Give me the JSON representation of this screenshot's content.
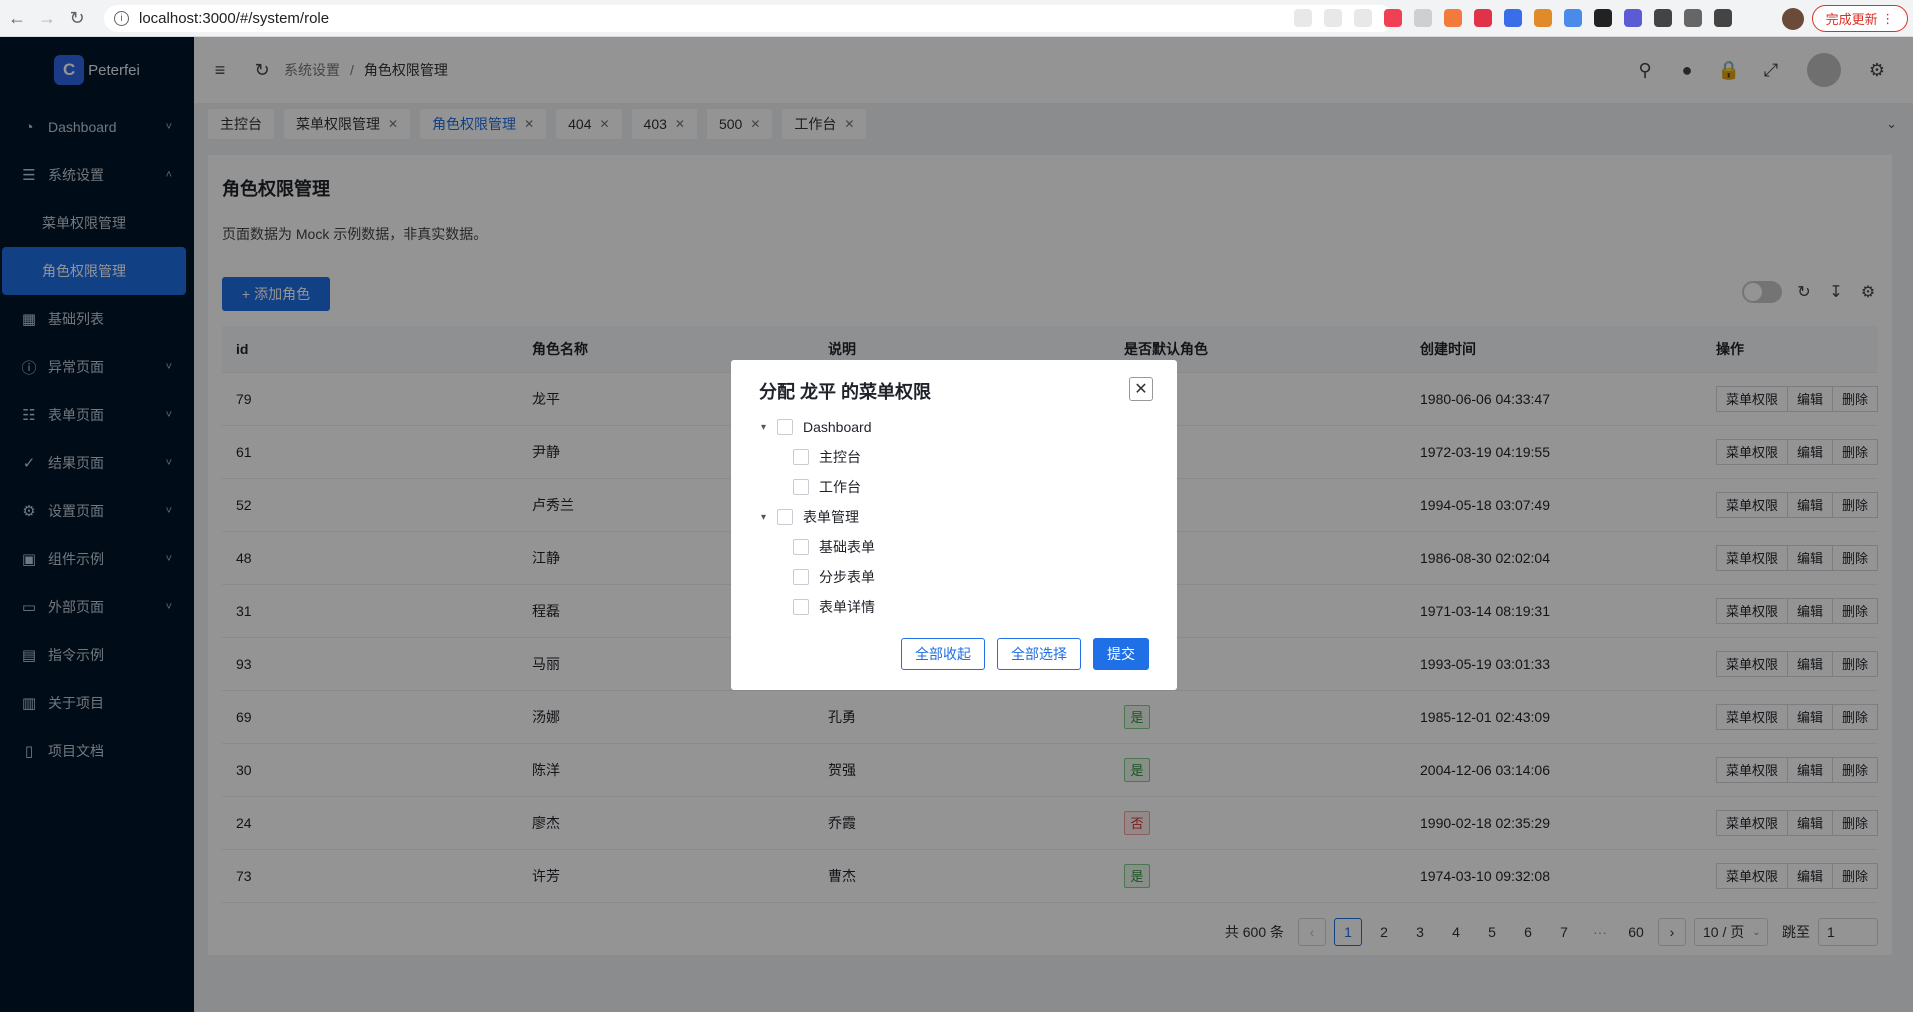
{
  "browser": {
    "url": "localhost:3000/#/system/role",
    "update_label": "完成更新"
  },
  "sidebar": {
    "brand": "Peterfei",
    "items": [
      {
        "label": "Dashboard",
        "icon": "dashboard-icon",
        "expandable": true
      },
      {
        "label": "系统设置",
        "icon": "settings-sliders-icon",
        "expandable": true,
        "expanded": true
      },
      {
        "label": "基础列表",
        "icon": "table-icon",
        "expandable": false
      },
      {
        "label": "异常页面",
        "icon": "exclamation-icon",
        "expandable": true
      },
      {
        "label": "表单页面",
        "icon": "form-icon",
        "expandable": true
      },
      {
        "label": "结果页面",
        "icon": "check-circle-icon",
        "expandable": true
      },
      {
        "label": "设置页面",
        "icon": "gear-icon",
        "expandable": true
      },
      {
        "label": "组件示例",
        "icon": "component-icon",
        "expandable": true
      },
      {
        "label": "外部页面",
        "icon": "desktop-icon",
        "expandable": true
      },
      {
        "label": "指令示例",
        "icon": "directive-icon",
        "expandable": false
      },
      {
        "label": "关于项目",
        "icon": "project-icon",
        "expandable": false
      },
      {
        "label": "项目文档",
        "icon": "document-icon",
        "expandable": false
      }
    ],
    "submenu": [
      {
        "label": "菜单权限管理",
        "active": false
      },
      {
        "label": "角色权限管理",
        "active": true
      }
    ]
  },
  "header": {
    "breadcrumb": [
      "系统设置",
      "角色权限管理"
    ],
    "breadcrumb_sep": "/"
  },
  "tabs": [
    {
      "label": "主控台",
      "closable": false,
      "active": false
    },
    {
      "label": "菜单权限管理",
      "closable": true,
      "active": false
    },
    {
      "label": "角色权限管理",
      "closable": true,
      "active": true
    },
    {
      "label": "404",
      "closable": true,
      "active": false
    },
    {
      "label": "403",
      "closable": true,
      "active": false
    },
    {
      "label": "500",
      "closable": true,
      "active": false
    },
    {
      "label": "工作台",
      "closable": true,
      "active": false
    }
  ],
  "page": {
    "title": "角色权限管理",
    "description": "页面数据为 Mock 示例数据，非真实数据。",
    "add_button": "添加角色"
  },
  "table": {
    "columns": [
      "id",
      "角色名称",
      "说明",
      "是否默认角色",
      "创建时间",
      "操作"
    ],
    "actions": [
      "菜单权限",
      "编辑",
      "删除"
    ],
    "rows": [
      {
        "id": "79",
        "name": "龙平",
        "desc": "",
        "default": "",
        "created": "1980-06-06 04:33:47"
      },
      {
        "id": "61",
        "name": "尹静",
        "desc": "",
        "default": "",
        "created": "1972-03-19 04:19:55"
      },
      {
        "id": "52",
        "name": "卢秀兰",
        "desc": "",
        "default": "",
        "created": "1994-05-18 03:07:49"
      },
      {
        "id": "48",
        "name": "江静",
        "desc": "",
        "default": "",
        "created": "1986-08-30 02:02:04"
      },
      {
        "id": "31",
        "name": "程磊",
        "desc": "",
        "default": "",
        "created": "1971-03-14 08:19:31"
      },
      {
        "id": "93",
        "name": "马丽",
        "desc": "",
        "default": "",
        "created": "1993-05-19 03:01:33"
      },
      {
        "id": "69",
        "name": "汤娜",
        "desc": "孔勇",
        "default": "是",
        "created": "1985-12-01 02:43:09"
      },
      {
        "id": "30",
        "name": "陈洋",
        "desc": "贺强",
        "default": "是",
        "created": "2004-12-06 03:14:06"
      },
      {
        "id": "24",
        "name": "廖杰",
        "desc": "乔霞",
        "default": "否",
        "created": "1990-02-18 02:35:29"
      },
      {
        "id": "73",
        "name": "许芳",
        "desc": "曹杰",
        "default": "是",
        "created": "1974-03-10 09:32:08"
      }
    ]
  },
  "pagination": {
    "total": "共 600 条",
    "pages": [
      "1",
      "2",
      "3",
      "4",
      "5",
      "6",
      "7",
      "···",
      "60"
    ],
    "current": "1",
    "page_size": "10 / 页",
    "jump_label": "跳至",
    "jump_value": "1"
  },
  "modal": {
    "title": "分配 龙平 的菜单权限",
    "tree": [
      {
        "label": "Dashboard",
        "children": [
          "主控台",
          "工作台"
        ]
      },
      {
        "label": "表单管理",
        "children": [
          "基础表单",
          "分步表单",
          "表单详情"
        ]
      }
    ],
    "buttons": {
      "collapse_all": "全部收起",
      "select_all": "全部选择",
      "submit": "提交"
    }
  },
  "colors": {
    "primary": "#1f6fe6",
    "sidebar_bg": "#001529",
    "tag_yes": "#2f8f3a",
    "tag_no": "#d43030"
  }
}
